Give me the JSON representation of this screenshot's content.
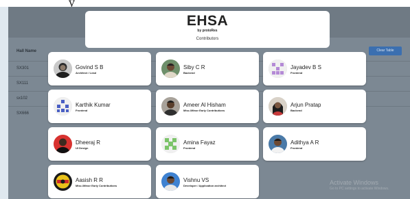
{
  "top_fragment": "y",
  "table": {
    "header": "Hall Name",
    "rows": [
      "SX301",
      "SX111",
      "sx102",
      "SX666"
    ],
    "clear_label": "Clear Table"
  },
  "header_card": {
    "brand": "EHSA",
    "subtitle": "by protoRes",
    "section": "Contributors"
  },
  "contributors": [
    {
      "name": "Govind S B",
      "role": "Architect / Lead",
      "avatar": "photo-avatar-bw"
    },
    {
      "name": "Siby C R",
      "role": "Backend",
      "avatar": "photo-avatar"
    },
    {
      "name": "Jayadev B S",
      "role": "Frontend",
      "avatar": "identicon-purple"
    },
    {
      "name": "Karthik Kumar",
      "role": "Frontend",
      "avatar": "identicon-blue"
    },
    {
      "name": "Ameer Al Hisham",
      "role": "Misc./Minor Early Contributions",
      "avatar": "photo-avatar"
    },
    {
      "name": "Arjun Pratap",
      "role": "Backend",
      "avatar": "photo-avatar"
    },
    {
      "name": "Dheeraj R",
      "role": "UI Design",
      "avatar": "photo-avatar-red"
    },
    {
      "name": "Amina Fayaz",
      "role": "Frontend",
      "avatar": "identicon-green"
    },
    {
      "name": "Adithya A R",
      "role": "Frontend",
      "avatar": "photo-avatar"
    },
    {
      "name": "Aasish R R",
      "role": "Misc./Minor Early Contributions",
      "avatar": "photo-avatar-logo"
    },
    {
      "name": "Vishnu VS",
      "role": "Developer / Application architect",
      "avatar": "photo-avatar-blue"
    }
  ],
  "watermark": {
    "title": "Activate Windows",
    "subtitle": "Go to PC settings to activate Windows."
  },
  "colors": {
    "overlay": "#7c8893",
    "accent_button": "#3b6fb0",
    "card": "#ffffff"
  }
}
